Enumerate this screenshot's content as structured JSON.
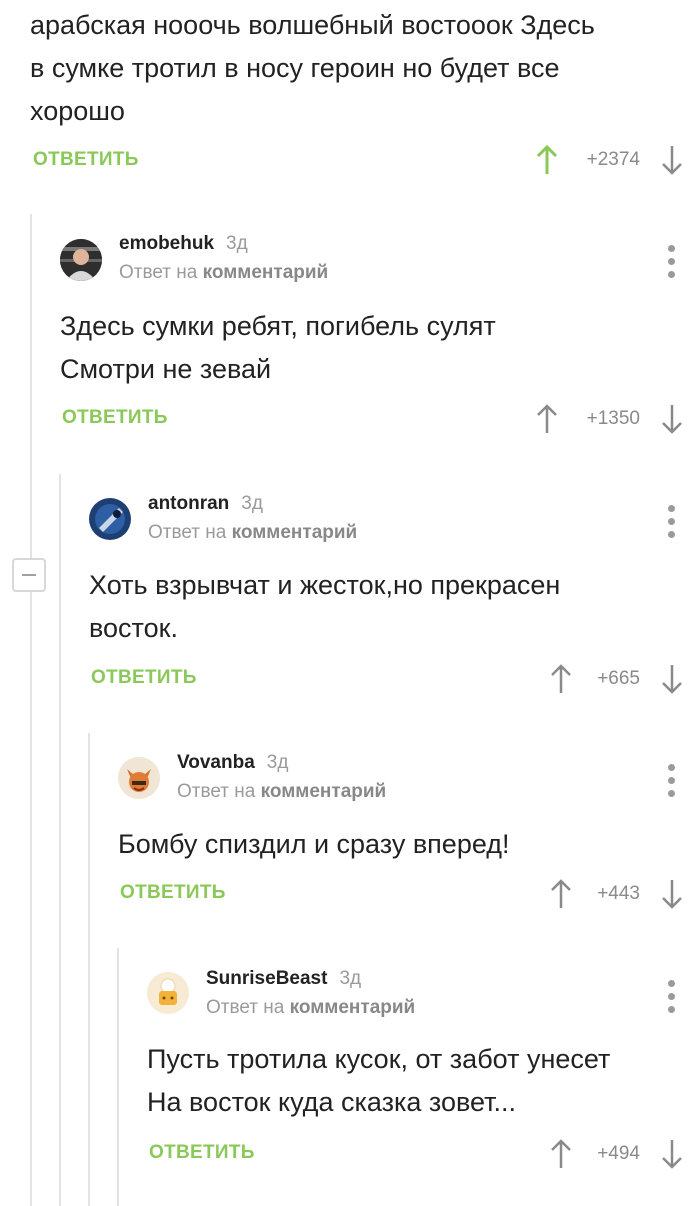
{
  "top_comment": {
    "text": "арабская нооочь волшебный востооок Здесь\nв сумке тротил в носу героин но будет все\nхорошо",
    "reply_label": "ОТВЕТИТЬ",
    "score": "+2374",
    "upvote_color": "#8ac858"
  },
  "comments": [
    {
      "author": "emobehuk",
      "age": "3д",
      "meta_prefix": "Ответ на",
      "meta_link": "комментарий",
      "text": "Здесь сумки ребят, погибель сулят\nСмотри не зевай",
      "reply_label": "ОТВЕТИТЬ",
      "score": "+1350"
    },
    {
      "author": "antonran",
      "age": "3д",
      "meta_prefix": "Ответ на",
      "meta_link": "комментарий",
      "text": "Хоть взрывчат и жесток,но прекрасен\nвосток.",
      "reply_label": "ОТВЕТИТЬ",
      "score": "+665"
    },
    {
      "author": "Vovanba",
      "age": "3д",
      "meta_prefix": "Ответ на",
      "meta_link": "комментарий",
      "text": "Бомбу спиздил и сразу вперед!",
      "reply_label": "ОТВЕТИТЬ",
      "score": "+443"
    },
    {
      "author": "SunriseBeast",
      "age": "3д",
      "meta_prefix": "Ответ на",
      "meta_link": "комментарий",
      "text": "Пусть тротила кусок, от забот унесет\nНа восток куда сказка зовет...",
      "reply_label": "ОТВЕТИТЬ",
      "score": "+494"
    }
  ],
  "colors": {
    "accent": "#8ac858",
    "thread_line": "#e3e3e3",
    "muted": "#9a9a9a"
  }
}
